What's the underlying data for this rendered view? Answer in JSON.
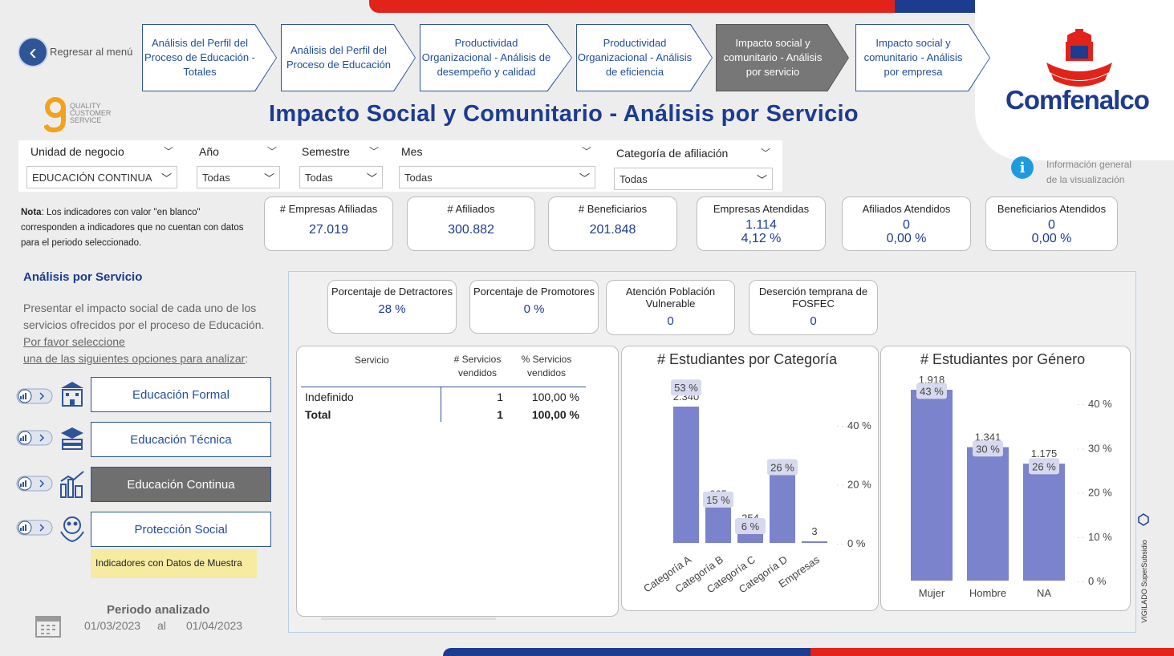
{
  "nav": {
    "back_label": "Regresar al menú",
    "tabs": [
      {
        "label": "Análisis del Perfil del Proceso de Educación - Totales"
      },
      {
        "label": "Análisis del Perfil del Proceso de Educación"
      },
      {
        "label": "Productividad Organizacional - Análisis de desempeño y calidad"
      },
      {
        "label": "Productividad Organizacional - Análisis de eficiencia"
      },
      {
        "label": "Impacto social y comunitario - Análisis por servicio"
      },
      {
        "label": "Impacto social y comunitario - Análisis por empresa"
      }
    ],
    "active_tab": 4
  },
  "brand": {
    "logo_text": "Comfenalco",
    "qcs_line1": "QUALITY",
    "qcs_line2": "CUSTOMER",
    "qcs_line3": "SERVICE"
  },
  "page_title": "Impacto Social y Comunitario - Análisis por Servicio",
  "filters": {
    "unidad": {
      "label": "Unidad de negocio",
      "value": "EDUCACIÓN CONTINUA"
    },
    "anio": {
      "label": "Año",
      "value": "Todas"
    },
    "semestre": {
      "label": "Semestre",
      "value": "Todas"
    },
    "mes": {
      "label": "Mes",
      "value": "Todas"
    },
    "categoria": {
      "label": "Categoría de afiliación",
      "value": "Todas"
    }
  },
  "info": {
    "line1": "Información general",
    "line2": "de la visualización"
  },
  "note": {
    "bold": "Nota",
    "text": ": Los indicadores con valor \"en blanco\" corresponden a indicadores que no cuentan con datos para el periodo seleccionado."
  },
  "kpis": [
    {
      "title": "# Empresas Afiliadas",
      "value": "27.019"
    },
    {
      "title": "# Afiliados",
      "value": "300.882"
    },
    {
      "title": "# Beneficiarios",
      "value": "201.848"
    },
    {
      "title": "Empresas Atendidas",
      "value": "1.114",
      "pct": "4,12 %"
    },
    {
      "title": "Afiliados Atendidos",
      "value": "0",
      "pct": "0,00 %"
    },
    {
      "title": "Beneficiarios Atendidos",
      "value": "0",
      "pct": "0,00 %"
    }
  ],
  "left": {
    "title": "Análisis por Servicio",
    "desc": "Presentar el impacto social de cada uno de los servicios ofrecidos por el proceso de Educación.",
    "link1": "Por favor seleccione",
    "link2": "una de las siguientes opciones para analizar",
    "link2_suffix": ":",
    "services": [
      {
        "label": "Educación Formal",
        "icon": "school-building-icon"
      },
      {
        "label": "Educación Técnica",
        "icon": "books-stack-icon"
      },
      {
        "label": "Educación Continua",
        "icon": "city-growth-icon",
        "active": true
      },
      {
        "label": "Protección Social",
        "icon": "protected-family-icon"
      }
    ],
    "sample_label": "Indicadores con Datos de Muestra",
    "periodo_label": "Periodo analizado",
    "date_from": "01/03/2023",
    "date_sep": "al",
    "date_to": "01/04/2023"
  },
  "mini_kpis": [
    {
      "title": "Porcentaje de Detractores",
      "value": "28 %"
    },
    {
      "title": "Porcentaje de Promotores",
      "value": "0 %"
    },
    {
      "title": "Atención Población Vulnerable",
      "value": "0"
    },
    {
      "title": "Deserción temprana de FOSFEC",
      "value": "0"
    }
  ],
  "table": {
    "headers": [
      "Servicio",
      "# Servicios vendidos",
      "% Servicios vendidos"
    ],
    "rows": [
      [
        "Indefinido",
        "1",
        "100,00 %"
      ]
    ],
    "total": [
      "Total",
      "1",
      "100,00 %"
    ]
  },
  "chart_data": [
    {
      "type": "bar",
      "title": "# Estudiantes por Categoría",
      "categories": [
        "Categoría A",
        "Categoría B",
        "Categoría C",
        "Categoría D",
        "Empresas"
      ],
      "values": [
        2340,
        665,
        254,
        1172,
        3
      ],
      "value_labels": [
        "2.340",
        "665",
        "254",
        "1.172",
        "3"
      ],
      "pct_labels": [
        "53 %",
        "15 %",
        "6 %",
        "26 %",
        ""
      ],
      "pct_values": [
        53,
        15,
        6,
        26,
        0
      ],
      "y2_ticks": [
        "40 %",
        "20 %",
        "0 %"
      ],
      "bar_color": "#7b83cc"
    },
    {
      "type": "bar",
      "title": "# Estudiantes por Género",
      "categories": [
        "Mujer",
        "Hombre",
        "NA"
      ],
      "values": [
        1918,
        1341,
        1175
      ],
      "value_labels": [
        "1.918",
        "1.341",
        "1.175"
      ],
      "pct_labels": [
        "43 %",
        "30 %",
        "26 %"
      ],
      "pct_values": [
        43,
        30,
        26
      ],
      "y2_ticks": [
        "40 %",
        "30 %",
        "20 %",
        "10 %",
        "0 %"
      ],
      "bar_color": "#7b83cc"
    }
  ],
  "vigilado": "VIGILADO SuperSubsidio"
}
